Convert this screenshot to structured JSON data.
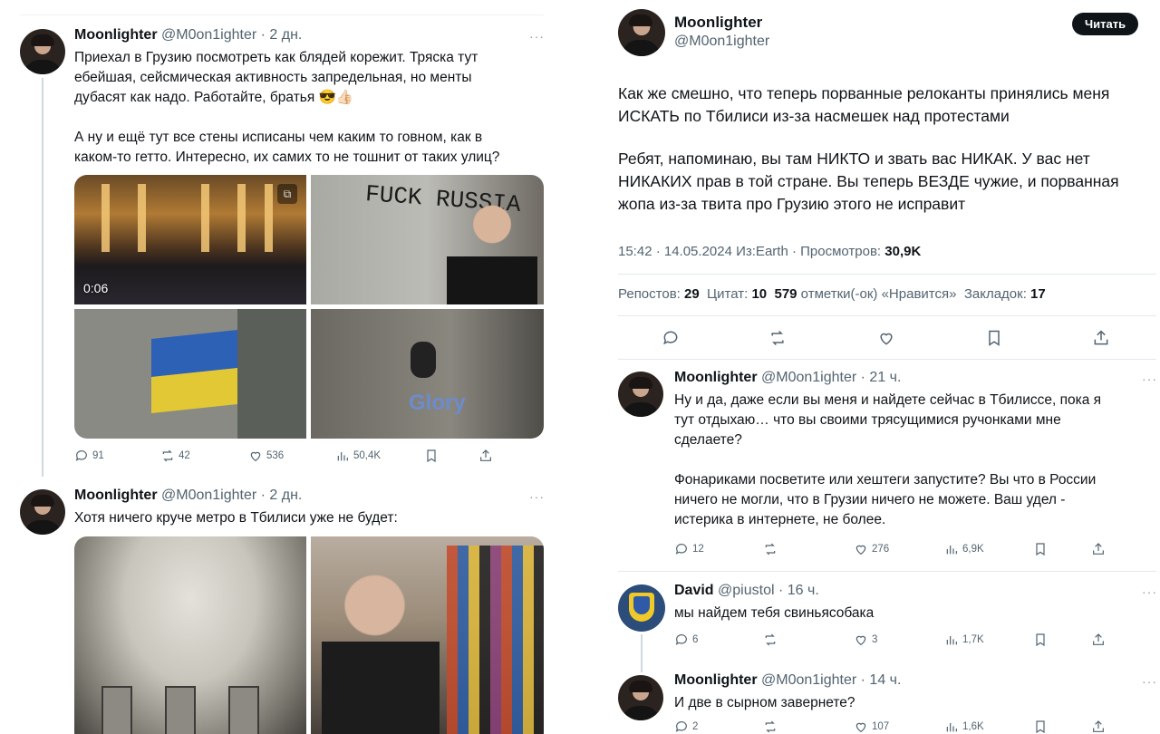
{
  "left_tweets": [
    {
      "name": "Moonlighter",
      "handle": "@M0on1ighter",
      "time": "· 2 дн.",
      "more": "···",
      "paragraphs": [
        "Приехал в Грузию посмотреть как блядей корежит. Тряска тут",
        "ебейшая, сейсмическая активность запредельная, но менты",
        "дубасят как надо. Работайте, братья 😎👍🏻",
        "",
        "А ну и ещё тут все стены исписаны чем каким то говном, как в",
        "каком-то гетто. Интересно, их самих то не тошнит от таких улиц?"
      ],
      "video_duration": "0:06",
      "graffiti_text": "FUCK RUSSIA",
      "glory_text": "Glory",
      "stats": {
        "replies": "91",
        "reposts": "42",
        "likes": "536",
        "views": "50,4K"
      }
    },
    {
      "name": "Moonlighter",
      "handle": "@M0on1ighter",
      "time": "· 2 дн.",
      "more": "···",
      "paragraphs": [
        "Хотя ничего круче метро в Тбилиси уже не будет:"
      ]
    }
  ],
  "main_tweet": {
    "name": "Moonlighter",
    "handle": "@M0on1ighter",
    "follow_label": "Читать",
    "paragraphs": [
      "Как же смешно, что теперь порванные релоканты принялись меня",
      "ИСКАТЬ по Тбилиси из-за насмешек над протестами",
      "",
      "Ребят, напоминаю, вы там НИКТО и звать вас НИКАК. У вас нет",
      "НИКАКИХ прав в той стране. Вы теперь ВЕЗДЕ чужие, и порванная",
      "жопа из-за твита про Грузию этого не исправит"
    ],
    "timestamp": "15:42 · 14.05.2024 Из:Earth · Просмотров: ",
    "views": "30,9K",
    "reposts_label": "Репостов: ",
    "reposts": "29",
    "quotes_label": "Цитат: ",
    "quotes": "10",
    "likes": "579",
    "likes_label": " отметки(-ок) «Нравится»",
    "bookmarks_label": "Закладок: ",
    "bookmarks": "17"
  },
  "replies": [
    {
      "name": "Moonlighter",
      "handle": "@M0on1ighter",
      "time": "· 21 ч.",
      "more": "···",
      "paragraphs": [
        "Ну и да, даже если вы меня и найдете сейчас в Тбилиссе, пока я",
        "тут отдыхаю… что вы своими трясущимися ручонками мне",
        "сделаете?",
        "",
        "Фонариками посветите или хештеги запустите? Вы что в России",
        "ничего не могли, что в Грузии ничего не можете. Ваш удел -",
        "истерика в интернете, не более."
      ],
      "stats": {
        "replies": "12",
        "reposts": "",
        "likes": "276",
        "views": "6,9K"
      }
    },
    {
      "name": "David",
      "handle": "@piustol",
      "time": "· 16 ч.",
      "more": "···",
      "paragraphs": [
        "мы найдем тебя свиньясобака"
      ],
      "stats": {
        "replies": "6",
        "reposts": "",
        "likes": "3",
        "views": "1,7K"
      }
    },
    {
      "name": "Moonlighter",
      "handle": "@M0on1ighter",
      "time": "· 14 ч.",
      "more": "···",
      "paragraphs": [
        "И две в сырном завернете?"
      ],
      "stats": {
        "replies": "2",
        "reposts": "",
        "likes": "107",
        "views": "1,6K"
      }
    }
  ],
  "icons": {
    "reply": "reply-icon",
    "repost": "repost-icon",
    "like": "heart-icon",
    "views": "views-icon",
    "bookmark": "bookmark-icon",
    "share": "share-icon"
  },
  "colors": {
    "text": "#0f1419",
    "muted": "#536471",
    "divider": "#e1e8ed",
    "follow_bg": "#0f1419"
  }
}
